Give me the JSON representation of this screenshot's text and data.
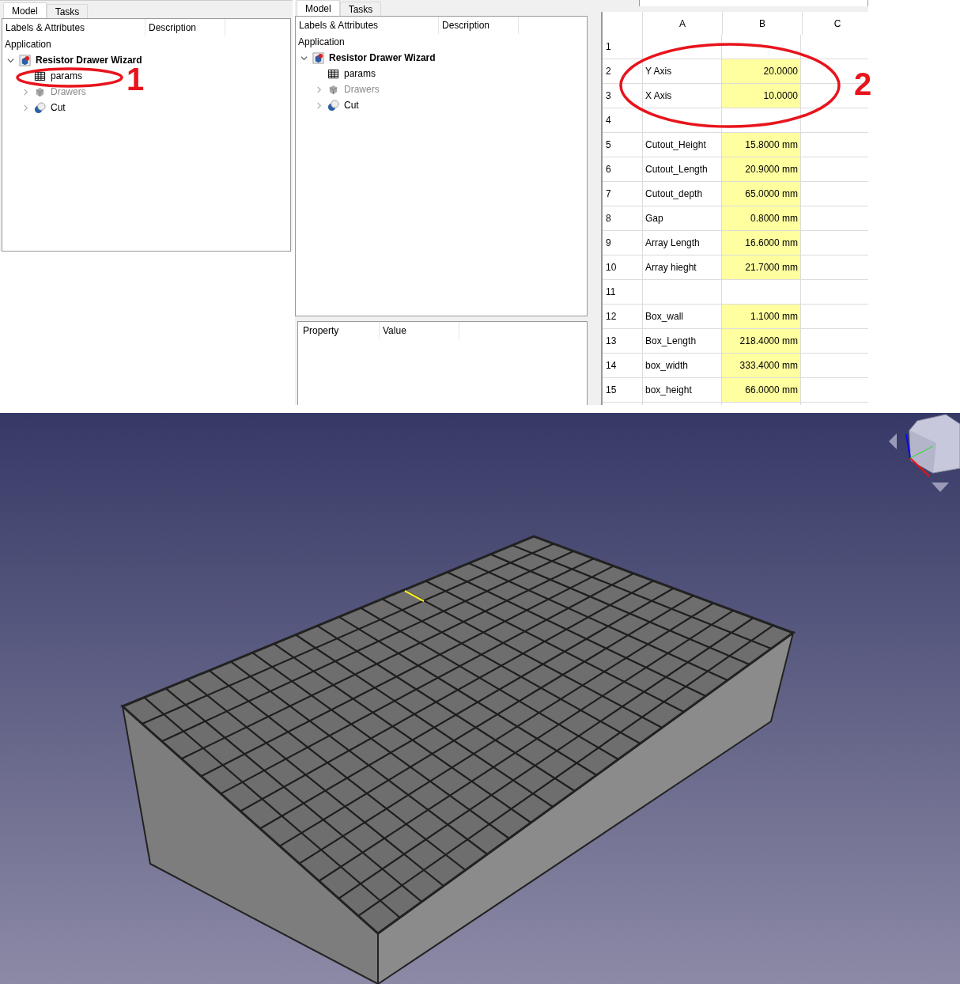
{
  "left_panel": {
    "tabs": [
      {
        "label": "Model",
        "selected": true
      },
      {
        "label": "Tasks",
        "selected": false
      }
    ],
    "tree": {
      "columns": [
        "Labels & Attributes",
        "Description"
      ],
      "root": "Application",
      "items": [
        {
          "label": "Resistor Drawer Wizard",
          "kind": "document",
          "expanded": true,
          "children": [
            {
              "label": "params",
              "kind": "spreadsheet"
            },
            {
              "label": "Drawers",
              "kind": "part",
              "greyed": true,
              "expanded": false
            },
            {
              "label": "Cut",
              "kind": "cut",
              "expanded": false
            }
          ]
        }
      ]
    }
  },
  "middle_panel": {
    "tabs": [
      {
        "label": "Model",
        "selected": true
      },
      {
        "label": "Tasks",
        "selected": false
      }
    ],
    "tree": {
      "columns": [
        "Labels & Attributes",
        "Description"
      ],
      "root": "Application",
      "items": [
        {
          "label": "Resistor Drawer Wizard",
          "kind": "document",
          "expanded": true,
          "children": [
            {
              "label": "params",
              "kind": "spreadsheet"
            },
            {
              "label": "Drawers",
              "kind": "part",
              "greyed": true,
              "expanded": false
            },
            {
              "label": "Cut",
              "kind": "cut",
              "expanded": false
            }
          ]
        }
      ]
    },
    "property_view": {
      "columns": [
        "Property",
        "Value"
      ]
    }
  },
  "spreadsheet": {
    "columns": [
      "A",
      "B",
      "C"
    ],
    "rows": [
      {
        "number": "1"
      },
      {
        "number": "2",
        "a": "Y Axis",
        "b": "20.0000"
      },
      {
        "number": "3",
        "a": "X Axis",
        "b": "10.0000"
      },
      {
        "number": "4"
      },
      {
        "number": "5",
        "a": "Cutout_Height",
        "b": "15.8000 mm"
      },
      {
        "number": "6",
        "a": "Cutout_Length",
        "b": "20.9000 mm"
      },
      {
        "number": "7",
        "a": "Cutout_depth",
        "b": "65.0000 mm"
      },
      {
        "number": "8",
        "a": "Gap",
        "b": "0.8000 mm"
      },
      {
        "number": "9",
        "a": "Array Length",
        "b": "16.6000 mm"
      },
      {
        "number": "10",
        "a": "Array hieght",
        "b": "21.7000 mm"
      },
      {
        "number": "11"
      },
      {
        "number": "12",
        "a": "Box_wall",
        "b": "1.1000 mm"
      },
      {
        "number": "13",
        "a": "Box_Length",
        "b": "218.4000 mm"
      },
      {
        "number": "14",
        "a": "box_width",
        "b": "333.4000 mm"
      },
      {
        "number": "15",
        "a": "box_height",
        "b": "66.0000 mm"
      }
    ]
  },
  "annotations": [
    {
      "label": "1"
    },
    {
      "label": "2"
    }
  ]
}
